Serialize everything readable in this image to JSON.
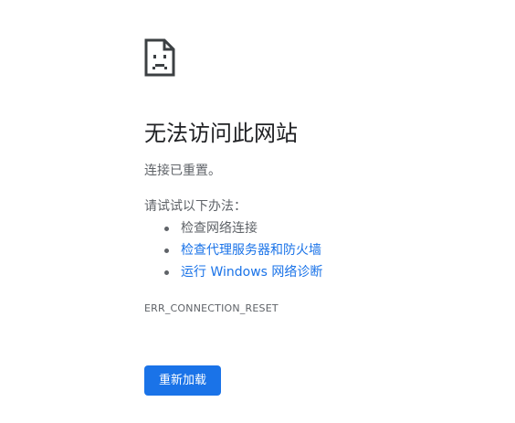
{
  "error_page": {
    "icon": "sad-page-icon",
    "title": "无法访问此网站",
    "summary": "连接已重置。",
    "try_label": "请试试以下办法：",
    "suggestions": [
      {
        "label": "检查网络连接",
        "is_link": false
      },
      {
        "label": "检查代理服务器和防火墙",
        "is_link": true
      },
      {
        "label": "运行 Windows 网络诊断",
        "is_link": true
      }
    ],
    "error_code": "ERR_CONNECTION_RESET",
    "reload_button": "重新加载"
  },
  "colors": {
    "text_primary": "#202124",
    "text_secondary": "#5f6368",
    "link": "#1a73e8",
    "button_bg": "#1a73e8",
    "button_text": "#ffffff"
  }
}
